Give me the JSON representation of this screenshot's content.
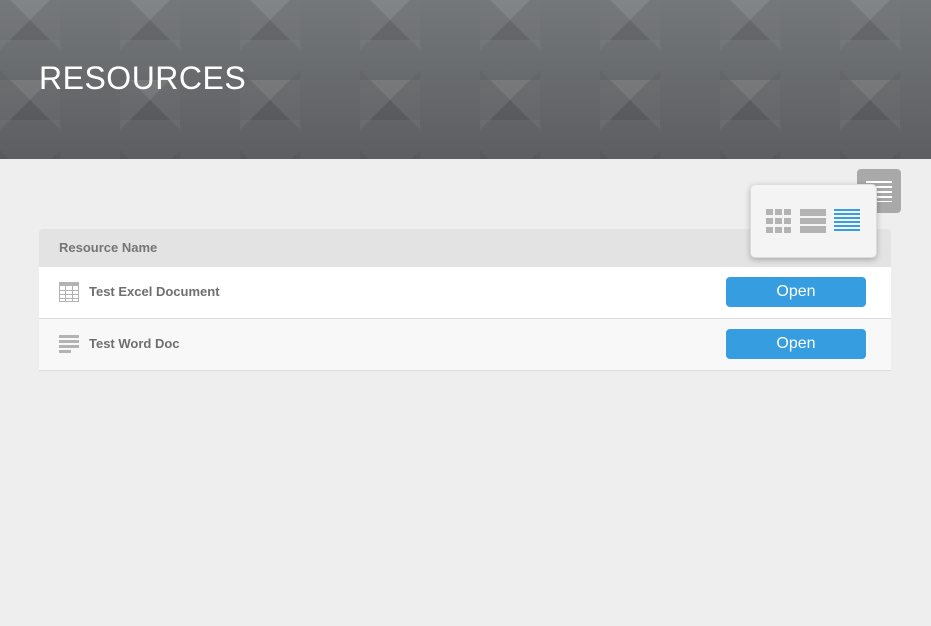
{
  "header": {
    "title": "RESOURCES"
  },
  "view_switcher": {
    "toggle_icon": "list-icon",
    "options": [
      {
        "icon": "grid-view-icon",
        "active": false
      },
      {
        "icon": "row-view-icon",
        "active": false
      },
      {
        "icon": "list-view-icon",
        "active": true
      }
    ]
  },
  "table": {
    "column_header": "Resource Name",
    "rows": [
      {
        "name": "Test Excel Document",
        "icon": "spreadsheet-icon",
        "action": "Open"
      },
      {
        "name": "Test Word Doc",
        "icon": "document-icon",
        "action": "Open"
      }
    ]
  },
  "colors": {
    "accent": "#369ee0",
    "header_bg": "#6b6d70",
    "page_bg": "#eeeeee",
    "icon_grey": "#b3b3b3"
  }
}
